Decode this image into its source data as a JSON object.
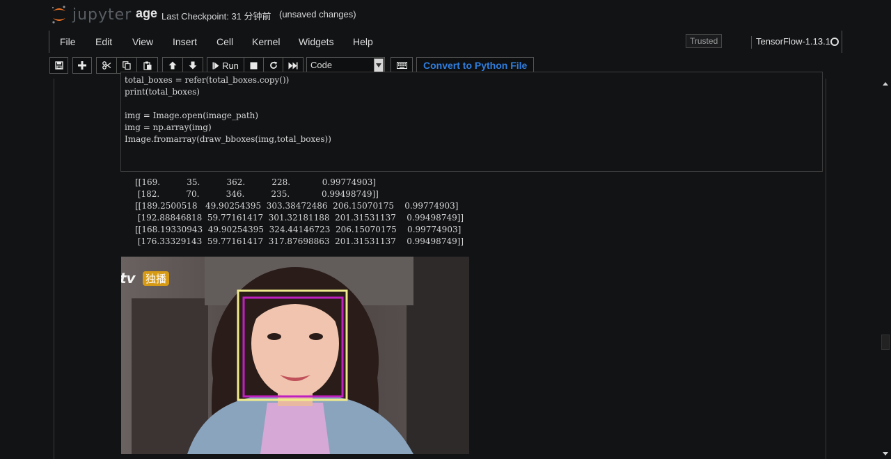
{
  "header": {
    "logo_text": "jupyter",
    "notebook_name": "age",
    "checkpoint": "Last Checkpoint: 31 分钟前",
    "autosave_status": "(unsaved changes)"
  },
  "menubar": {
    "items": [
      "File",
      "Edit",
      "View",
      "Insert",
      "Cell",
      "Kernel",
      "Widgets",
      "Help"
    ],
    "trusted_label": "Trusted",
    "kernel_name": "TensorFlow-1.13.1"
  },
  "toolbar": {
    "run_label": "Run",
    "cell_type": "Code",
    "convert_label": "Convert to Python File"
  },
  "code_cell": {
    "lines": [
      "total_boxes = refer(total_boxes.copy())",
      "print(total_boxes)",
      "",
      "img = Image.open(image_path)",
      "img = np.array(img)",
      "Image.fromarray(draw_bboxes(img,total_boxes))"
    ]
  },
  "output": {
    "lines": [
      "[[169.          35.          362.          228.            0.99774903]",
      " [182.          70.          346.          235.            0.99498749]]",
      "[[189.2500518   49.90254395  303.38472486  206.15070175    0.99774903]",
      " [192.88846818  59.77161417  301.32181188  201.31531137    0.99498749]]",
      "[[168.19330943  49.90254395  324.44146723  206.15070175    0.99774903]",
      " [176.33329143  59.77161417  317.87698863  201.31531137    0.99498749]]"
    ],
    "image": {
      "watermark_brand": "tv",
      "watermark_tag": "独播",
      "box_colors": {
        "outer": "#f0eb8c",
        "inner": "#c020c0"
      }
    }
  },
  "colors": {
    "background": "#111315",
    "accent_link": "#2f7fe0",
    "logo_orange": "#f37626"
  }
}
